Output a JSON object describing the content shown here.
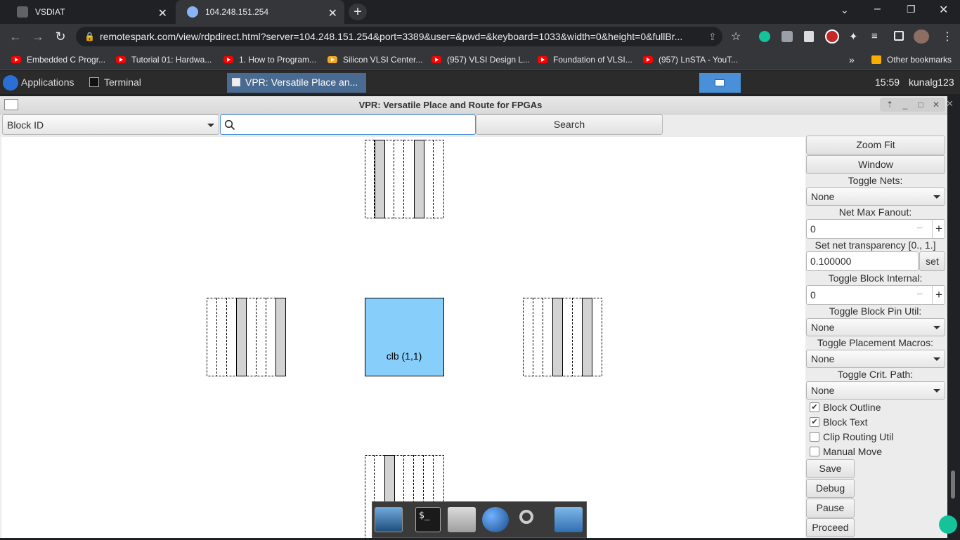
{
  "browser": {
    "tabs": [
      {
        "title": "VSDIAT"
      },
      {
        "title": "104.248.151.254"
      }
    ],
    "url": "remotespark.com/view/rdpdirect.html?server=104.248.151.254&port=3389&user=&pwd=&keyboard=1033&width=0&height=0&fullBr...",
    "bookmarks": [
      {
        "label": "Embedded C Progr..."
      },
      {
        "label": "Tutorial 01: Hardwa..."
      },
      {
        "label": "1. How to Program..."
      },
      {
        "label": "Silicon VLSI Center..."
      },
      {
        "label": "(957) VLSI Design L..."
      },
      {
        "label": "Foundation of VLSI..."
      },
      {
        "label": "(957) LnSTA - YouT..."
      }
    ],
    "more_bookmarks": "»",
    "other_bookmarks": "Other bookmarks"
  },
  "panel": {
    "applications": "Applications",
    "terminal": "Terminal",
    "active_task": "VPR: Versatile Place an...",
    "clock": "15:59",
    "user": "kunalg123"
  },
  "vpr": {
    "title": "VPR: Versatile Place and Route for FPGAs",
    "search_field": "Block ID",
    "search_value": "",
    "search_button": "Search",
    "clb_label": "clb (1,1)",
    "clb_color": "#87cefa",
    "side": {
      "zoom_fit": "Zoom Fit",
      "window": "Window",
      "toggle_nets_label": "Toggle Nets:",
      "toggle_nets_value": "None",
      "net_max_fanout_label": "Net Max Fanout:",
      "net_max_fanout_value": "0",
      "net_transparency_label": "Set net transparency [0., 1.]",
      "net_transparency_value": "0.100000",
      "set_button": "set",
      "toggle_block_internal_label": "Toggle Block Internal:",
      "toggle_block_internal_value": "0",
      "toggle_block_pin_util_label": "Toggle Block Pin Util:",
      "toggle_block_pin_util_value": "None",
      "toggle_placement_macros_label": "Toggle Placement Macros:",
      "toggle_placement_macros_value": "None",
      "toggle_crit_path_label": "Toggle Crit. Path:",
      "toggle_crit_path_value": "None",
      "block_outline": "Block Outline",
      "block_outline_checked": true,
      "block_text": "Block Text",
      "block_text_checked": true,
      "clip_routing_util": "Clip Routing Util",
      "clip_routing_util_checked": false,
      "manual_move": "Manual Move",
      "manual_move_checked": false,
      "save": "Save",
      "debug": "Debug",
      "pause": "Pause",
      "proceed": "Proceed"
    }
  }
}
